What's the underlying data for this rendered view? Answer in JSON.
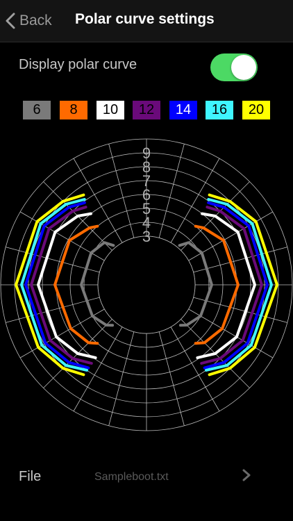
{
  "nav": {
    "back_label": "Back",
    "title": "Polar curve settings"
  },
  "display_toggle": {
    "label": "Display polar curve",
    "on": true,
    "on_color": "#4cd964"
  },
  "legend": [
    {
      "label": "6",
      "bg": "#7a7a7a",
      "fg": "#000000"
    },
    {
      "label": "8",
      "bg": "#ff6a00",
      "fg": "#000000"
    },
    {
      "label": "10",
      "bg": "#ffffff",
      "fg": "#000000"
    },
    {
      "label": "12",
      "bg": "#6a0a7a",
      "fg": "#000000"
    },
    {
      "label": "14",
      "bg": "#0000ff",
      "fg": "#ffffff"
    },
    {
      "label": "16",
      "bg": "#3ff5ff",
      "fg": "#000000"
    },
    {
      "label": "20",
      "bg": "#ffff00",
      "fg": "#000000"
    }
  ],
  "chart_data": {
    "type": "polar",
    "radial_labels": [
      "3",
      "4",
      "5",
      "6",
      "7",
      "8",
      "9"
    ],
    "rings": [
      3,
      4,
      5,
      6,
      7,
      8,
      9,
      10
    ],
    "angle_step_deg": 15,
    "series": [
      {
        "name": "6",
        "color": "#7a7a7a",
        "points": [
          [
            40,
            3.2
          ],
          [
            45,
            3.8
          ],
          [
            60,
            4.1
          ],
          [
            90,
            4.2
          ],
          [
            120,
            4.0
          ],
          [
            135,
            3.6
          ],
          [
            140,
            3.3
          ]
        ]
      },
      {
        "name": "8",
        "color": "#ff6a00",
        "points": [
          [
            40,
            5.0
          ],
          [
            45,
            5.3
          ],
          [
            60,
            5.9
          ],
          [
            90,
            6.1
          ],
          [
            120,
            5.8
          ],
          [
            135,
            5.4
          ],
          [
            140,
            5.0
          ]
        ]
      },
      {
        "name": "10",
        "color": "#ffffff",
        "points": [
          [
            38,
            6.0
          ],
          [
            45,
            6.5
          ],
          [
            60,
            7.1
          ],
          [
            90,
            7.3
          ],
          [
            120,
            7.0
          ],
          [
            135,
            6.5
          ],
          [
            145,
            5.9
          ]
        ]
      },
      {
        "name": "12",
        "color": "#6a0a7a",
        "points": [
          [
            38,
            6.6
          ],
          [
            45,
            7.0
          ],
          [
            60,
            7.6
          ],
          [
            90,
            7.8
          ],
          [
            120,
            7.5
          ],
          [
            135,
            7.0
          ],
          [
            145,
            6.4
          ]
        ]
      },
      {
        "name": "14",
        "color": "#0000ff",
        "points": [
          [
            37,
            6.9
          ],
          [
            45,
            7.4
          ],
          [
            60,
            8.0
          ],
          [
            90,
            8.2
          ],
          [
            120,
            7.9
          ],
          [
            135,
            7.4
          ],
          [
            145,
            6.8
          ]
        ]
      },
      {
        "name": "16",
        "color": "#3ff5ff",
        "points": [
          [
            36,
            7.1
          ],
          [
            45,
            7.7
          ],
          [
            60,
            8.3
          ],
          [
            90,
            8.5
          ],
          [
            120,
            8.2
          ],
          [
            135,
            7.7
          ],
          [
            145,
            7.0
          ]
        ]
      },
      {
        "name": "20",
        "color": "#ffff00",
        "points": [
          [
            35,
            7.4
          ],
          [
            45,
            8.0
          ],
          [
            60,
            8.6
          ],
          [
            90,
            8.9
          ],
          [
            120,
            8.5
          ],
          [
            135,
            8.0
          ],
          [
            145,
            7.4
          ]
        ]
      }
    ]
  },
  "file": {
    "label": "File",
    "value": "Sampleboot.txt"
  }
}
